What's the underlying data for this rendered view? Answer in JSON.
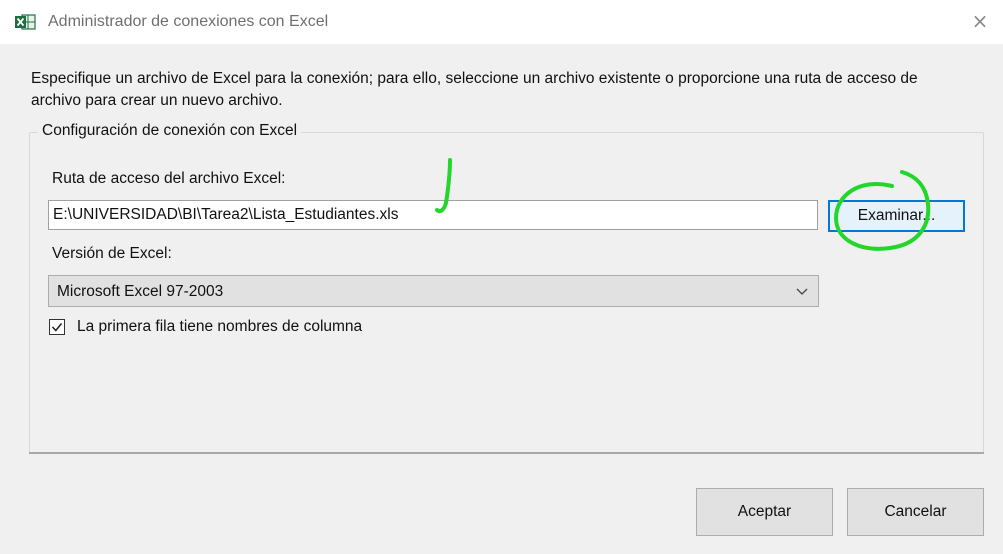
{
  "window": {
    "title": "Administrador de conexiones con Excel",
    "app_icon": "excel-icon",
    "close_icon": "close-icon",
    "close_glyph": "×"
  },
  "description": "Especifique un archivo de Excel para la conexión; para ello, seleccione un archivo existente o proporcione una ruta de acceso de archivo para crear un nuevo archivo.",
  "group": {
    "title": "Configuración de conexión con Excel",
    "path_label": "Ruta de acceso del archivo Excel:",
    "path_value": "E:\\UNIVERSIDAD\\BI\\Tarea2\\Lista_Estudiantes.xls",
    "browse_label": "Examinar...",
    "version_label": "Versión de Excel:",
    "version_value": "Microsoft Excel 97-2003",
    "first_row_label": "La primera fila tiene nombres de columna",
    "first_row_checked": true
  },
  "buttons": {
    "ok_label": "Aceptar",
    "cancel_label": "Cancelar"
  },
  "colors": {
    "focus_border": "#0078d7",
    "annotation": "#22d62a"
  }
}
